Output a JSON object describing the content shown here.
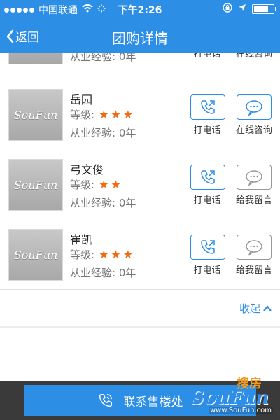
{
  "status_bar": {
    "carrier": "中国联通",
    "time": "下午2:26"
  },
  "nav": {
    "back_label": "返回",
    "title": "团购详情"
  },
  "list": {
    "partial_item": {
      "experience": "从业经验: 0年",
      "call_label": "打电话",
      "msg_label": "在线咨询"
    },
    "items": [
      {
        "thumb_text": "SouFun",
        "name": "岳园",
        "level_label": "等级:",
        "stars": 3,
        "experience": "从业经验: 0年",
        "call_label": "打电话",
        "msg_label": "在线咨询"
      },
      {
        "thumb_text": "SouFun",
        "name": "弓文俊",
        "level_label": "等级:",
        "stars": 2,
        "experience": "从业经验: 0年",
        "call_label": "打电话",
        "msg_label": "给我留言"
      },
      {
        "thumb_text": "SouFun",
        "name": "崔凯",
        "level_label": "等级:",
        "stars": 3,
        "experience": "从业经验: 0年",
        "call_label": "打电话",
        "msg_label": "给我留言"
      }
    ],
    "collapse_label": "收起"
  },
  "bottom": {
    "contact_label": "联系售楼处"
  },
  "watermark": {
    "text_cn": "搜房",
    "text_en": "SouFun",
    "domain": "www.SouFun.com"
  },
  "colors": {
    "accent": "#2d8ee6",
    "star": "#f06a13",
    "bottom_bar": "#3a3a3a"
  }
}
